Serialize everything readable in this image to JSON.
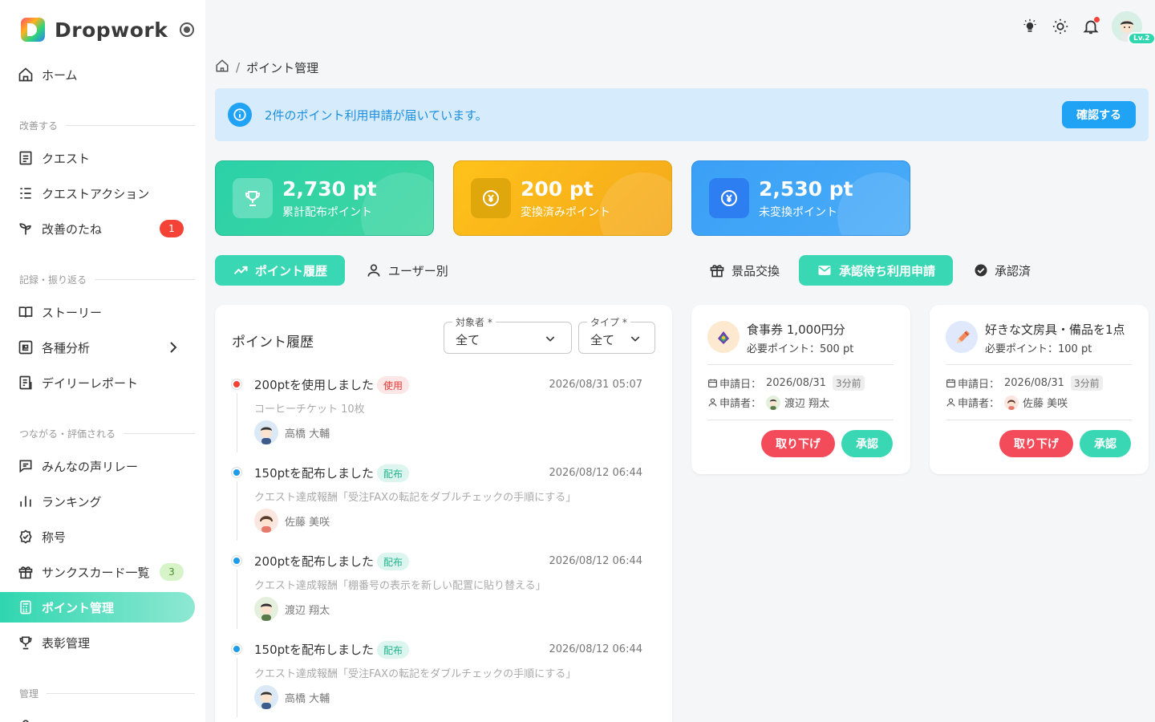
{
  "app": {
    "name": "Dropwork"
  },
  "sidebar": {
    "home": "ホーム",
    "sections": [
      "改善する",
      "記録・振り返る",
      "つながる・評価される",
      "管理"
    ],
    "items": [
      {
        "label": "クエスト"
      },
      {
        "label": "クエストアクション"
      },
      {
        "label": "改善のたね",
        "badge": "1"
      },
      {
        "label": "ストーリー"
      },
      {
        "label": "各種分析"
      },
      {
        "label": "デイリーレポート"
      },
      {
        "label": "みんなの声リレー"
      },
      {
        "label": "ランキング"
      },
      {
        "label": "称号"
      },
      {
        "label": "サンクスカード一覧",
        "badge": "3"
      },
      {
        "label": "ポイント管理"
      },
      {
        "label": "表彰管理"
      }
    ]
  },
  "header": {
    "level": "Lv.2"
  },
  "breadcrumb": {
    "current": "ポイント管理"
  },
  "alert": {
    "text": "2件のポイント利用申請が届いています。",
    "button": "確認する"
  },
  "stats": [
    {
      "value": "2,730 pt",
      "label": "累計配布ポイント",
      "color": "#2bd1a8"
    },
    {
      "value": "200 pt",
      "label": "変換済みポイント",
      "color": "#ffc21a"
    },
    {
      "value": "2,530 pt",
      "label": "未変換ポイント",
      "color": "#3aa0f6"
    }
  ],
  "tabs_left": [
    "ポイント履歴",
    "ユーザー別"
  ],
  "tabs_right": [
    "景品交換",
    "承認待ち利用申請",
    "承認済"
  ],
  "history": {
    "title": "ポイント履歴",
    "filters": [
      {
        "label": "対象者 *",
        "value": "全て"
      },
      {
        "label": "タイプ *",
        "value": "全て"
      }
    ],
    "items": [
      {
        "title": "200ptを使用しました",
        "tag": "使用",
        "date": "2026/08/31 05:07",
        "sub": "コーヒーチケット 10枚",
        "user": "高橋 大輔"
      },
      {
        "title": "150ptを配布しました",
        "tag": "配布",
        "date": "2026/08/12 06:44",
        "sub": "クエスト達成報酬「受注FAXの転記をダブルチェックの手順にする」",
        "user": "佐藤 美咲"
      },
      {
        "title": "200ptを配布しました",
        "tag": "配布",
        "date": "2026/08/12 06:44",
        "sub": "クエスト達成報酬「棚番号の表示を新しい配置に貼り替える」",
        "user": "渡辺 翔太"
      },
      {
        "title": "150ptを配布しました",
        "tag": "配布",
        "date": "2026/08/12 06:44",
        "sub": "クエスト達成報酬「受注FAXの転記をダブルチェックの手順にする」",
        "user": "高橋 大輔"
      }
    ]
  },
  "requests": [
    {
      "title": "食事券 1,000円分",
      "required": "必要ポイント：500 pt",
      "date_label": "申請日：",
      "date": "2026/08/31",
      "ago": "3分前",
      "applicant_label": "申請者：",
      "applicant": "渡辺 翔太",
      "withdraw": "取り下げ",
      "approve": "承認"
    },
    {
      "title": "好きな文房具・備品を1点",
      "required": "必要ポイント：100 pt",
      "date_label": "申請日：",
      "date": "2026/08/31",
      "ago": "3分前",
      "applicant_label": "申請者：",
      "applicant": "佐藤 美咲",
      "withdraw": "取り下げ",
      "approve": "承認"
    }
  ]
}
